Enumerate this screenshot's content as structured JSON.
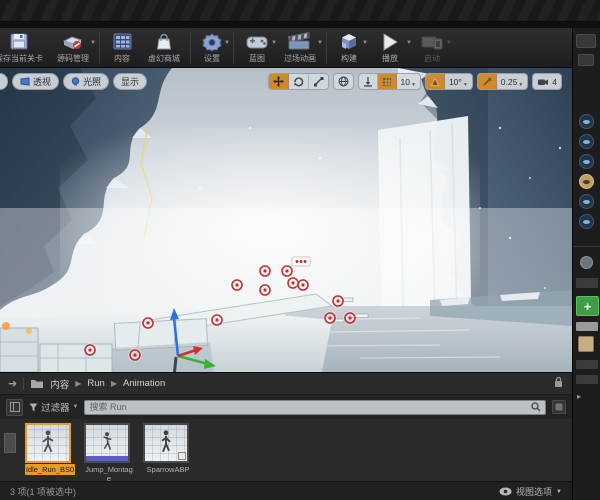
{
  "toolbar": {
    "items": [
      {
        "label": "保存当前关卡",
        "icon": "save-icon",
        "dropdown": false,
        "disabled": false
      },
      {
        "label": "源码管理",
        "icon": "source-control-icon",
        "dropdown": true,
        "disabled": false
      },
      {
        "label": "内容",
        "icon": "content-icon",
        "dropdown": false,
        "disabled": false
      },
      {
        "label": "虚幻商城",
        "icon": "marketplace-icon",
        "dropdown": false,
        "disabled": false
      },
      {
        "label": "设置",
        "icon": "settings-icon",
        "dropdown": true,
        "disabled": false
      },
      {
        "label": "蓝图",
        "icon": "blueprints-icon",
        "dropdown": true,
        "disabled": false
      },
      {
        "label": "过场动画",
        "icon": "cinematics-icon",
        "dropdown": true,
        "disabled": false
      },
      {
        "label": "构建",
        "icon": "build-icon",
        "dropdown": true,
        "disabled": false
      },
      {
        "label": "播放",
        "icon": "play-icon",
        "dropdown": true,
        "disabled": false
      },
      {
        "label": "启动",
        "icon": "launch-icon",
        "dropdown": true,
        "disabled": true
      }
    ]
  },
  "viewport": {
    "view_mode_label": "透视",
    "lit_mode_label": "光照",
    "show_label": "显示",
    "grid_snap_value": "10",
    "rotation_snap_value": "10°",
    "scale_snap_value": "0.25",
    "camera_speed_value": "4"
  },
  "content_browser": {
    "breadcrumb": {
      "root": "内容",
      "folder": "Run",
      "subfolder": "Animation"
    },
    "filters_label": "过滤器",
    "search_placeholder": "搜索 Run",
    "assets": [
      {
        "name": "Idle_Run_BS0",
        "selected": true
      },
      {
        "name": "Jump_Montage",
        "selected": false
      },
      {
        "name": "SparrowABP",
        "selected": false
      }
    ],
    "status_text": "3 项(1 项被选中)",
    "view_options_label": "视图选项"
  },
  "right_panel": {
    "add_button_glyph": "+"
  },
  "colors": {
    "accent_orange": "#d0892c",
    "selection_orange": "#e79b2d",
    "add_green": "#3f9e45",
    "target_red": "#c03030",
    "gizmo_x": "#d03030",
    "gizmo_y": "#35b535",
    "gizmo_z": "#2f6fe0"
  }
}
